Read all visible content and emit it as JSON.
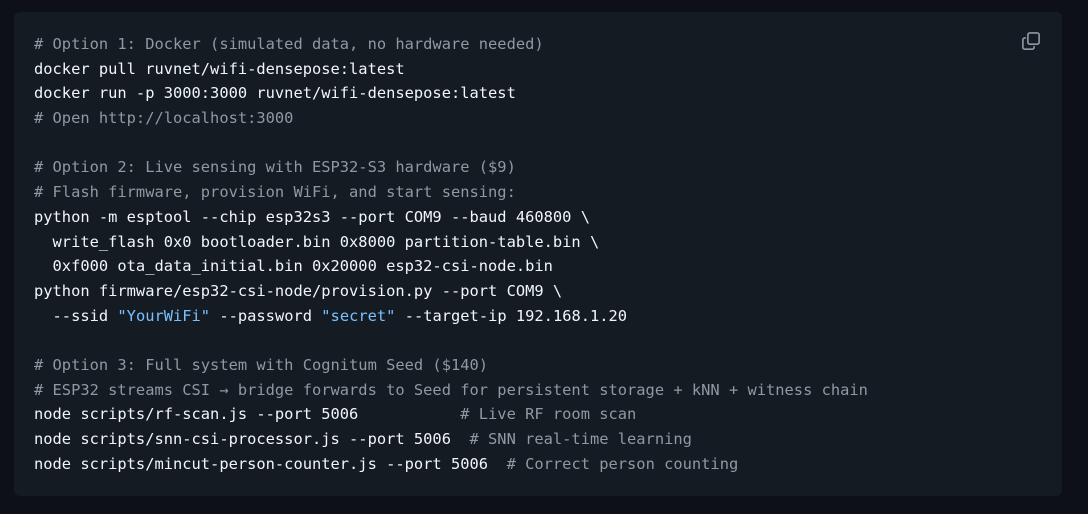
{
  "code_block": {
    "lines": [
      [
        {
          "type": "comment",
          "text": "# Option 1: Docker (simulated data, no hardware needed)"
        }
      ],
      [
        {
          "type": "plain",
          "text": "docker pull ruvnet/wifi-densepose:latest"
        }
      ],
      [
        {
          "type": "plain",
          "text": "docker run -p 3000:3000 ruvnet/wifi-densepose:latest"
        }
      ],
      [
        {
          "type": "comment",
          "text": "# Open http://localhost:3000"
        }
      ],
      [],
      [
        {
          "type": "comment",
          "text": "# Option 2: Live sensing with ESP32-S3 hardware ($9)"
        }
      ],
      [
        {
          "type": "comment",
          "text": "# Flash firmware, provision WiFi, and start sensing:"
        }
      ],
      [
        {
          "type": "plain",
          "text": "python -m esptool --chip esp32s3 --port COM9 --baud 460800 \\"
        }
      ],
      [
        {
          "type": "plain",
          "text": "  write_flash 0x0 bootloader.bin 0x8000 partition-table.bin \\"
        }
      ],
      [
        {
          "type": "plain",
          "text": "  0xf000 ota_data_initial.bin 0x20000 esp32-csi-node.bin"
        }
      ],
      [
        {
          "type": "plain",
          "text": "python firmware/esp32-csi-node/provision.py --port COM9 \\"
        }
      ],
      [
        {
          "type": "plain",
          "text": "  --ssid "
        },
        {
          "type": "string",
          "text": "\"YourWiFi\""
        },
        {
          "type": "plain",
          "text": " --password "
        },
        {
          "type": "string",
          "text": "\"secret\""
        },
        {
          "type": "plain",
          "text": " --target-ip 192.168.1.20"
        }
      ],
      [],
      [
        {
          "type": "comment",
          "text": "# Option 3: Full system with Cognitum Seed ($140)"
        }
      ],
      [
        {
          "type": "comment",
          "text": "# ESP32 streams CSI → bridge forwards to Seed for persistent storage + kNN + witness chain"
        }
      ],
      [
        {
          "type": "plain",
          "text": "node scripts/rf-scan.js --port 5006           "
        },
        {
          "type": "comment",
          "text": "# Live RF room scan"
        }
      ],
      [
        {
          "type": "plain",
          "text": "node scripts/snn-csi-processor.js --port 5006  "
        },
        {
          "type": "comment",
          "text": "# SNN real-time learning"
        }
      ],
      [
        {
          "type": "plain",
          "text": "node scripts/mincut-person-counter.js --port 5006  "
        },
        {
          "type": "comment",
          "text": "# Correct person counting"
        }
      ]
    ]
  },
  "copy_button": {
    "icon": "copy-icon",
    "icon_color": "#9198a1"
  },
  "colors": {
    "page_background": "#0d1117",
    "code_background": "#151b23",
    "plain_text": "#f0f6fc",
    "comment_text": "#9198a1",
    "string_text": "#79c0ff"
  }
}
